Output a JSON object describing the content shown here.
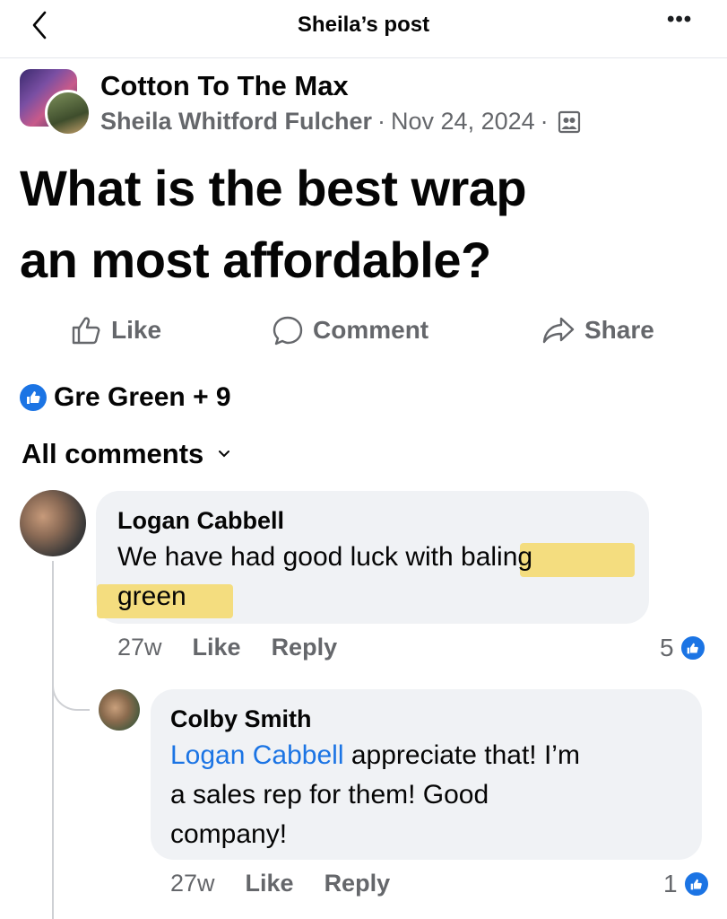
{
  "header": {
    "title": "Sheila’s post",
    "back_icon": "chevron-left-icon",
    "more_label": "•••"
  },
  "post": {
    "group_name": "Cotton To The Max",
    "author": "Sheila Whitford Fulcher",
    "separator": "·",
    "date": "Nov 24, 2024",
    "audience_icon": "group-members-icon",
    "text_line1": "What is the best wrap",
    "text_line2": "an most affordable?"
  },
  "actions": {
    "like": "Like",
    "comment": "Comment",
    "share": "Share"
  },
  "reactions": {
    "summary": "Gre Green + 9"
  },
  "comments_filter": {
    "label": "All comments",
    "icon": "chevron-down-icon"
  },
  "comments": [
    {
      "name": "Logan Cabbell",
      "text_before": "We have had good luck wit",
      "text_highlight": "h baling",
      "text_line2": "green",
      "age": "27w",
      "like": "Like",
      "reply": "Reply",
      "reaction_count": "5"
    },
    {
      "name": "Colby Smith",
      "mention": "Logan Cabbell",
      "text_after": " appreciate that! I’m",
      "text_line2": "a sales rep for them! Good",
      "text_line3": "company!",
      "age": "27w",
      "like": "Like",
      "reply": "Reply",
      "reaction_count": "1"
    }
  ],
  "colors": {
    "accent": "#1b74e4",
    "secondary_text": "#65676b",
    "bubble": "#f0f2f5",
    "highlight": "#f4dd7f"
  }
}
